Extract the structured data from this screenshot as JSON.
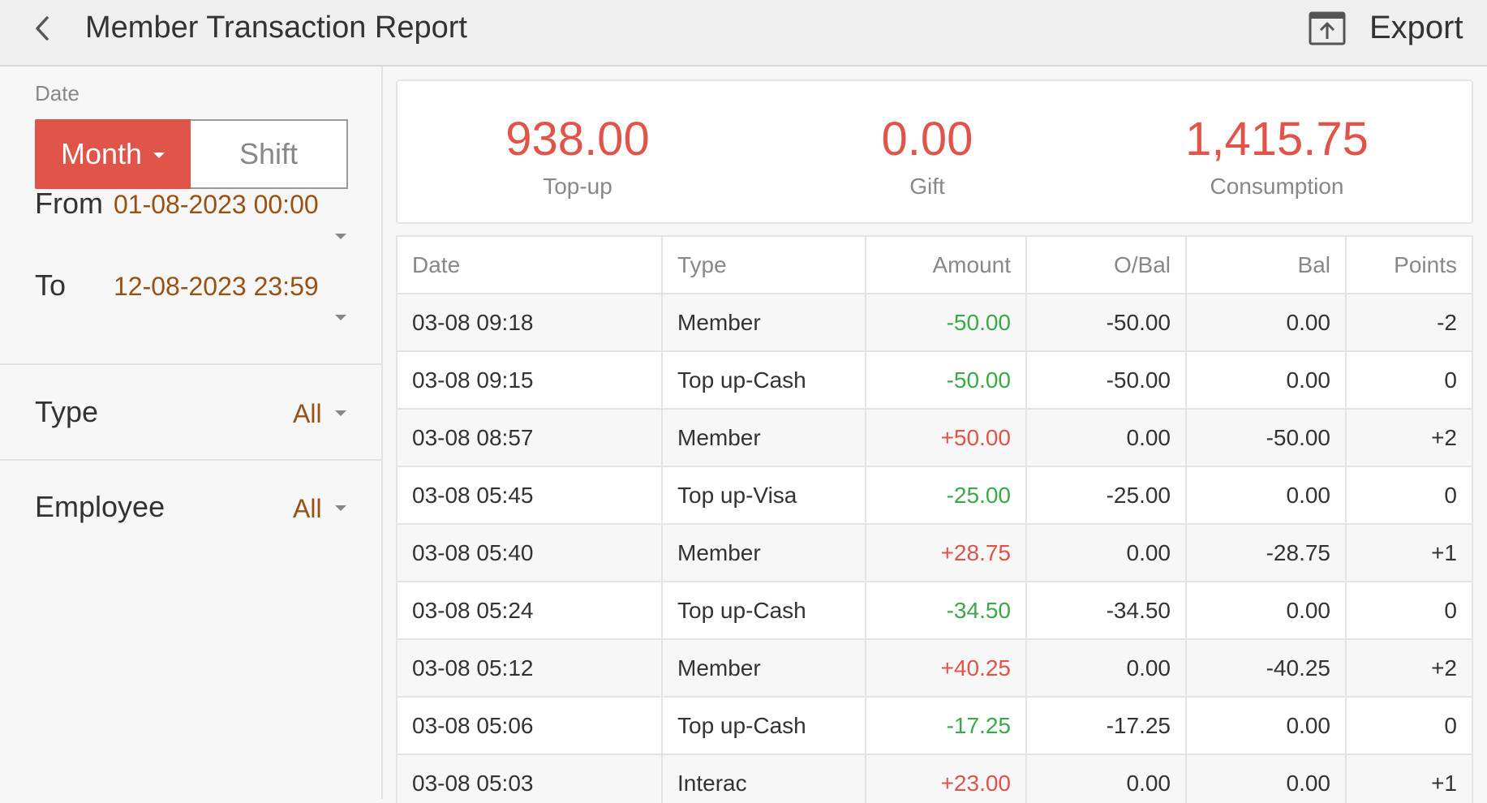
{
  "header": {
    "title": "Member Transaction Report",
    "export_label": "Export"
  },
  "filters": {
    "date_caption": "Date",
    "month_label": "Month",
    "shift_label": "Shift",
    "from_label": "From",
    "from_value": "01-08-2023 00:00",
    "to_label": "To",
    "to_value": "12-08-2023 23:59",
    "type_label": "Type",
    "type_value": "All",
    "employee_label": "Employee",
    "employee_value": "All"
  },
  "summary": [
    {
      "value": "938.00",
      "label": "Top-up"
    },
    {
      "value": "0.00",
      "label": "Gift"
    },
    {
      "value": "1,415.75",
      "label": "Consumption"
    }
  ],
  "table": {
    "headers": [
      "Date",
      "Type",
      "Amount",
      "O/Bal",
      "Bal",
      "Points"
    ],
    "rows": [
      {
        "date": "03-08 09:18",
        "type": "Member",
        "amount": "-50.00",
        "obal": "-50.00",
        "bal": "0.00",
        "points": "-2"
      },
      {
        "date": "03-08 09:15",
        "type": "Top up-Cash",
        "amount": "-50.00",
        "obal": "-50.00",
        "bal": "0.00",
        "points": "0"
      },
      {
        "date": "03-08 08:57",
        "type": "Member",
        "amount": "+50.00",
        "obal": "0.00",
        "bal": "-50.00",
        "points": "+2"
      },
      {
        "date": "03-08 05:45",
        "type": "Top up-Visa",
        "amount": "-25.00",
        "obal": "-25.00",
        "bal": "0.00",
        "points": "0"
      },
      {
        "date": "03-08 05:40",
        "type": "Member",
        "amount": "+28.75",
        "obal": "0.00",
        "bal": "-28.75",
        "points": "+1"
      },
      {
        "date": "03-08 05:24",
        "type": "Top up-Cash",
        "amount": "-34.50",
        "obal": "-34.50",
        "bal": "0.00",
        "points": "0"
      },
      {
        "date": "03-08 05:12",
        "type": "Member",
        "amount": "+40.25",
        "obal": "0.00",
        "bal": "-40.25",
        "points": "+2"
      },
      {
        "date": "03-08 05:06",
        "type": "Top up-Cash",
        "amount": "-17.25",
        "obal": "-17.25",
        "bal": "0.00",
        "points": "0"
      },
      {
        "date": "03-08 05:03",
        "type": "Interac",
        "amount": "+23.00",
        "obal": "0.00",
        "bal": "0.00",
        "points": "+1"
      }
    ]
  },
  "colors": {
    "accent": "#e0544a",
    "positive": "#e0544a",
    "negative": "#3aaa47",
    "date_value": "#9a5213"
  },
  "icons": {
    "back": "chevron-left-icon",
    "export": "export-icon"
  }
}
